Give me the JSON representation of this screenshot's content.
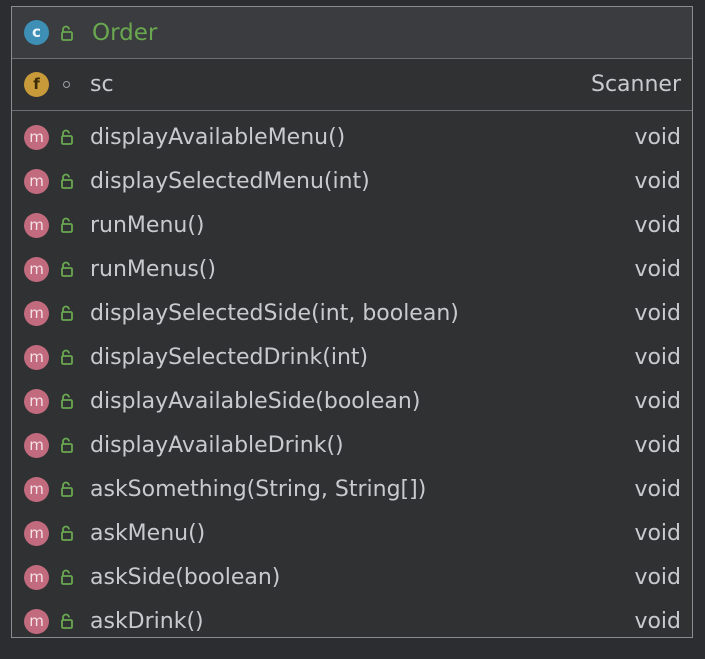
{
  "class": {
    "badge": "c",
    "name": "Order",
    "visibility_icon": "unlocked-public-icon"
  },
  "fields": [
    {
      "badge": "f",
      "visibility_icon": "package-private-dot-icon",
      "name": "sc",
      "type": "Scanner"
    }
  ],
  "methods": [
    {
      "badge": "m",
      "visibility_icon": "unlocked-public-icon",
      "name": "displayAvailableMenu()",
      "type": "void"
    },
    {
      "badge": "m",
      "visibility_icon": "unlocked-public-icon",
      "name": "displaySelectedMenu(int)",
      "type": "void"
    },
    {
      "badge": "m",
      "visibility_icon": "unlocked-public-icon",
      "name": "runMenu()",
      "type": "void"
    },
    {
      "badge": "m",
      "visibility_icon": "unlocked-public-icon",
      "name": "runMenus()",
      "type": "void"
    },
    {
      "badge": "m",
      "visibility_icon": "unlocked-public-icon",
      "name": "displaySelectedSide(int, boolean)",
      "type": "void"
    },
    {
      "badge": "m",
      "visibility_icon": "unlocked-public-icon",
      "name": "displaySelectedDrink(int)",
      "type": "void"
    },
    {
      "badge": "m",
      "visibility_icon": "unlocked-public-icon",
      "name": "displayAvailableSide(boolean)",
      "type": "void"
    },
    {
      "badge": "m",
      "visibility_icon": "unlocked-public-icon",
      "name": "displayAvailableDrink()",
      "type": "void"
    },
    {
      "badge": "m",
      "visibility_icon": "unlocked-public-icon",
      "name": "askSomething(String, String[])",
      "type": "void"
    },
    {
      "badge": "m",
      "visibility_icon": "unlocked-public-icon",
      "name": "askMenu()",
      "type": "void"
    },
    {
      "badge": "m",
      "visibility_icon": "unlocked-public-icon",
      "name": "askSide(boolean)",
      "type": "void"
    },
    {
      "badge": "m",
      "visibility_icon": "unlocked-public-icon",
      "name": "askDrink()",
      "type": "void"
    }
  ],
  "colors": {
    "class_badge": "#3d8fb5",
    "field_badge": "#c99a3a",
    "method_badge": "#c26a7e",
    "class_name": "#6aa84f",
    "lock_icon": "#6aa84f",
    "text": "#c8cace",
    "border": "#8a8d90"
  }
}
